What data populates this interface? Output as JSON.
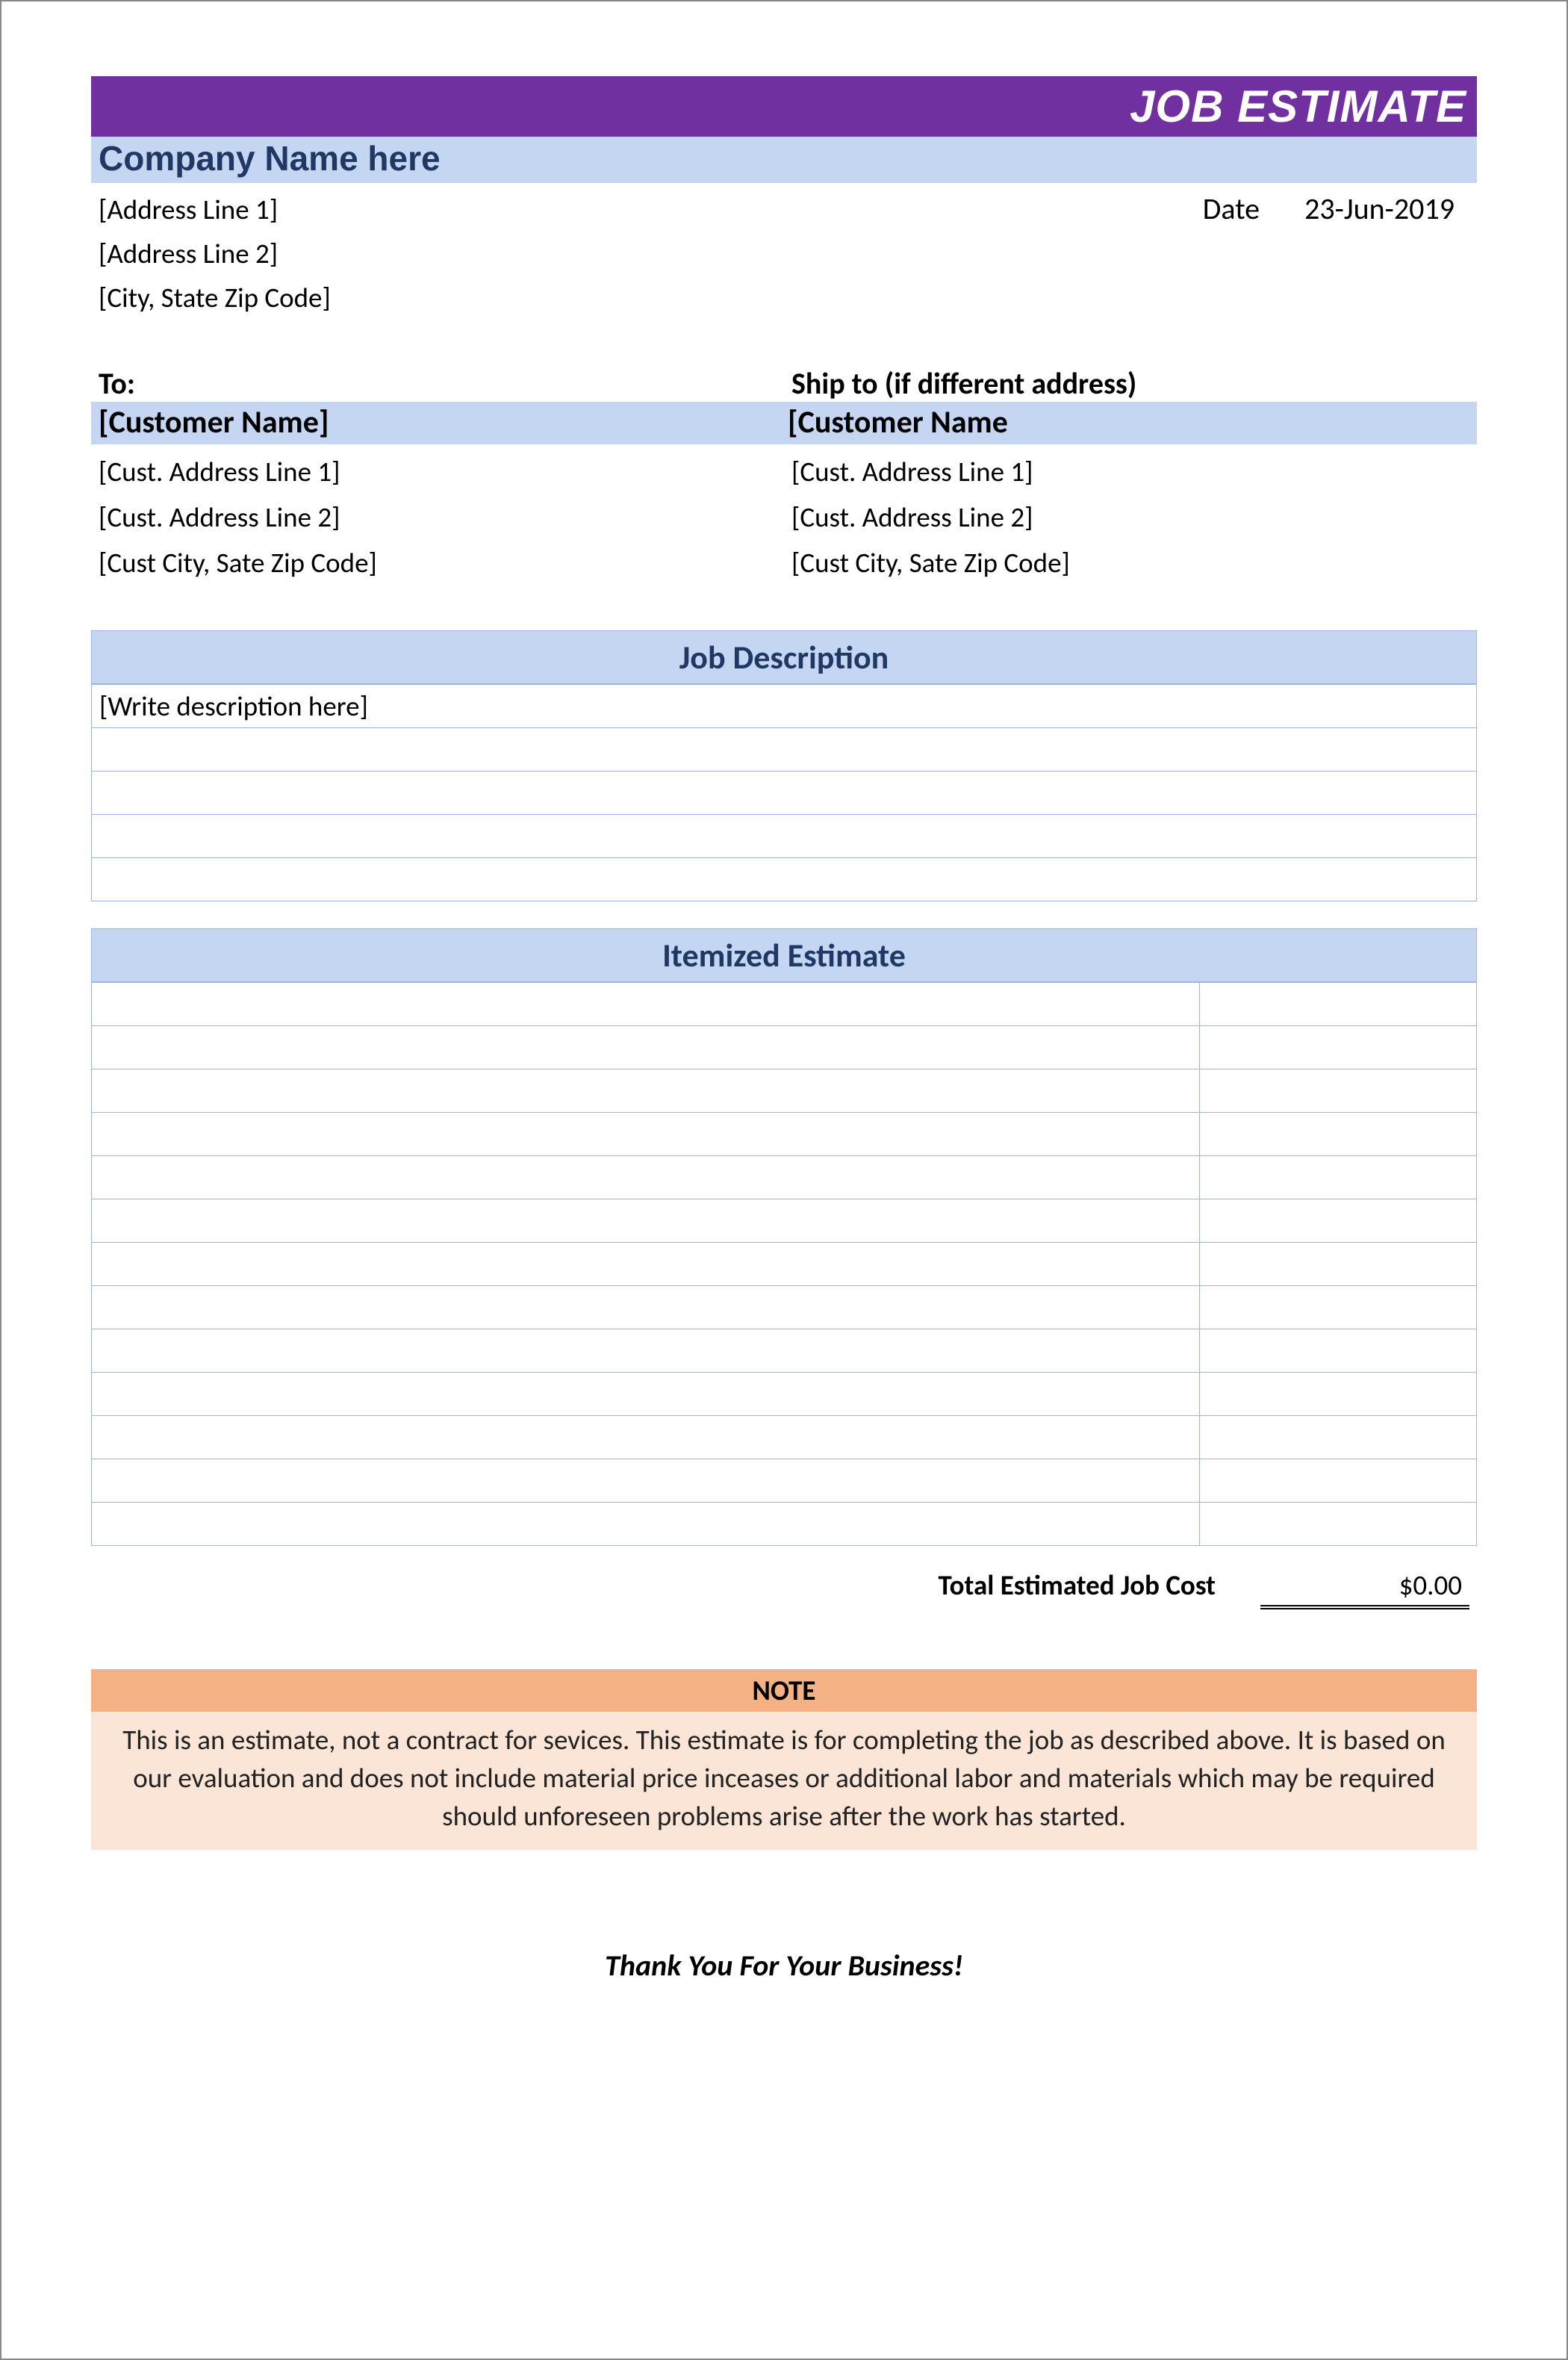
{
  "header": {
    "title": "JOB ESTIMATE",
    "company_name": "Company Name here",
    "address_line_1": "[Address Line 1]",
    "address_line_2": "[Address Line 2]",
    "city_state_zip": "[City, State Zip Code]",
    "date_label": "Date",
    "date_value": "23-Jun-2019"
  },
  "to": {
    "label": "To:",
    "customer_name": "[Customer Name]",
    "addr1": "[Cust. Address Line 1]",
    "addr2": "[Cust. Address Line 2]",
    "city": "[Cust City, Sate Zip Code]"
  },
  "ship_to": {
    "label": "Ship to (if different address)",
    "customer_name": "[Customer Name",
    "addr1": "[Cust. Address Line 1]",
    "addr2": "[Cust. Address Line 2]",
    "city": "[Cust City, Sate Zip Code]"
  },
  "job_description": {
    "title": "Job Description",
    "rows": [
      "[Write description here]",
      "",
      "",
      "",
      ""
    ]
  },
  "itemized": {
    "title": "Itemized Estimate",
    "rows": [
      {
        "desc": "",
        "amt": ""
      },
      {
        "desc": "",
        "amt": ""
      },
      {
        "desc": "",
        "amt": ""
      },
      {
        "desc": "",
        "amt": ""
      },
      {
        "desc": "",
        "amt": ""
      },
      {
        "desc": "",
        "amt": ""
      },
      {
        "desc": "",
        "amt": ""
      },
      {
        "desc": "",
        "amt": ""
      },
      {
        "desc": "",
        "amt": ""
      },
      {
        "desc": "",
        "amt": ""
      },
      {
        "desc": "",
        "amt": ""
      },
      {
        "desc": "",
        "amt": ""
      },
      {
        "desc": "",
        "amt": ""
      }
    ]
  },
  "total": {
    "label": "Total Estimated Job Cost",
    "value": "$0.00"
  },
  "note": {
    "title": "NOTE",
    "body": "This is an estimate, not a contract for sevices. This estimate is for completing the job as described above. It is based on our evaluation and does not include material price inceases or additional labor and materials which may be required should unforeseen problems arise after the work has started."
  },
  "footer": {
    "thank_you": "Thank You For Your Business!"
  }
}
